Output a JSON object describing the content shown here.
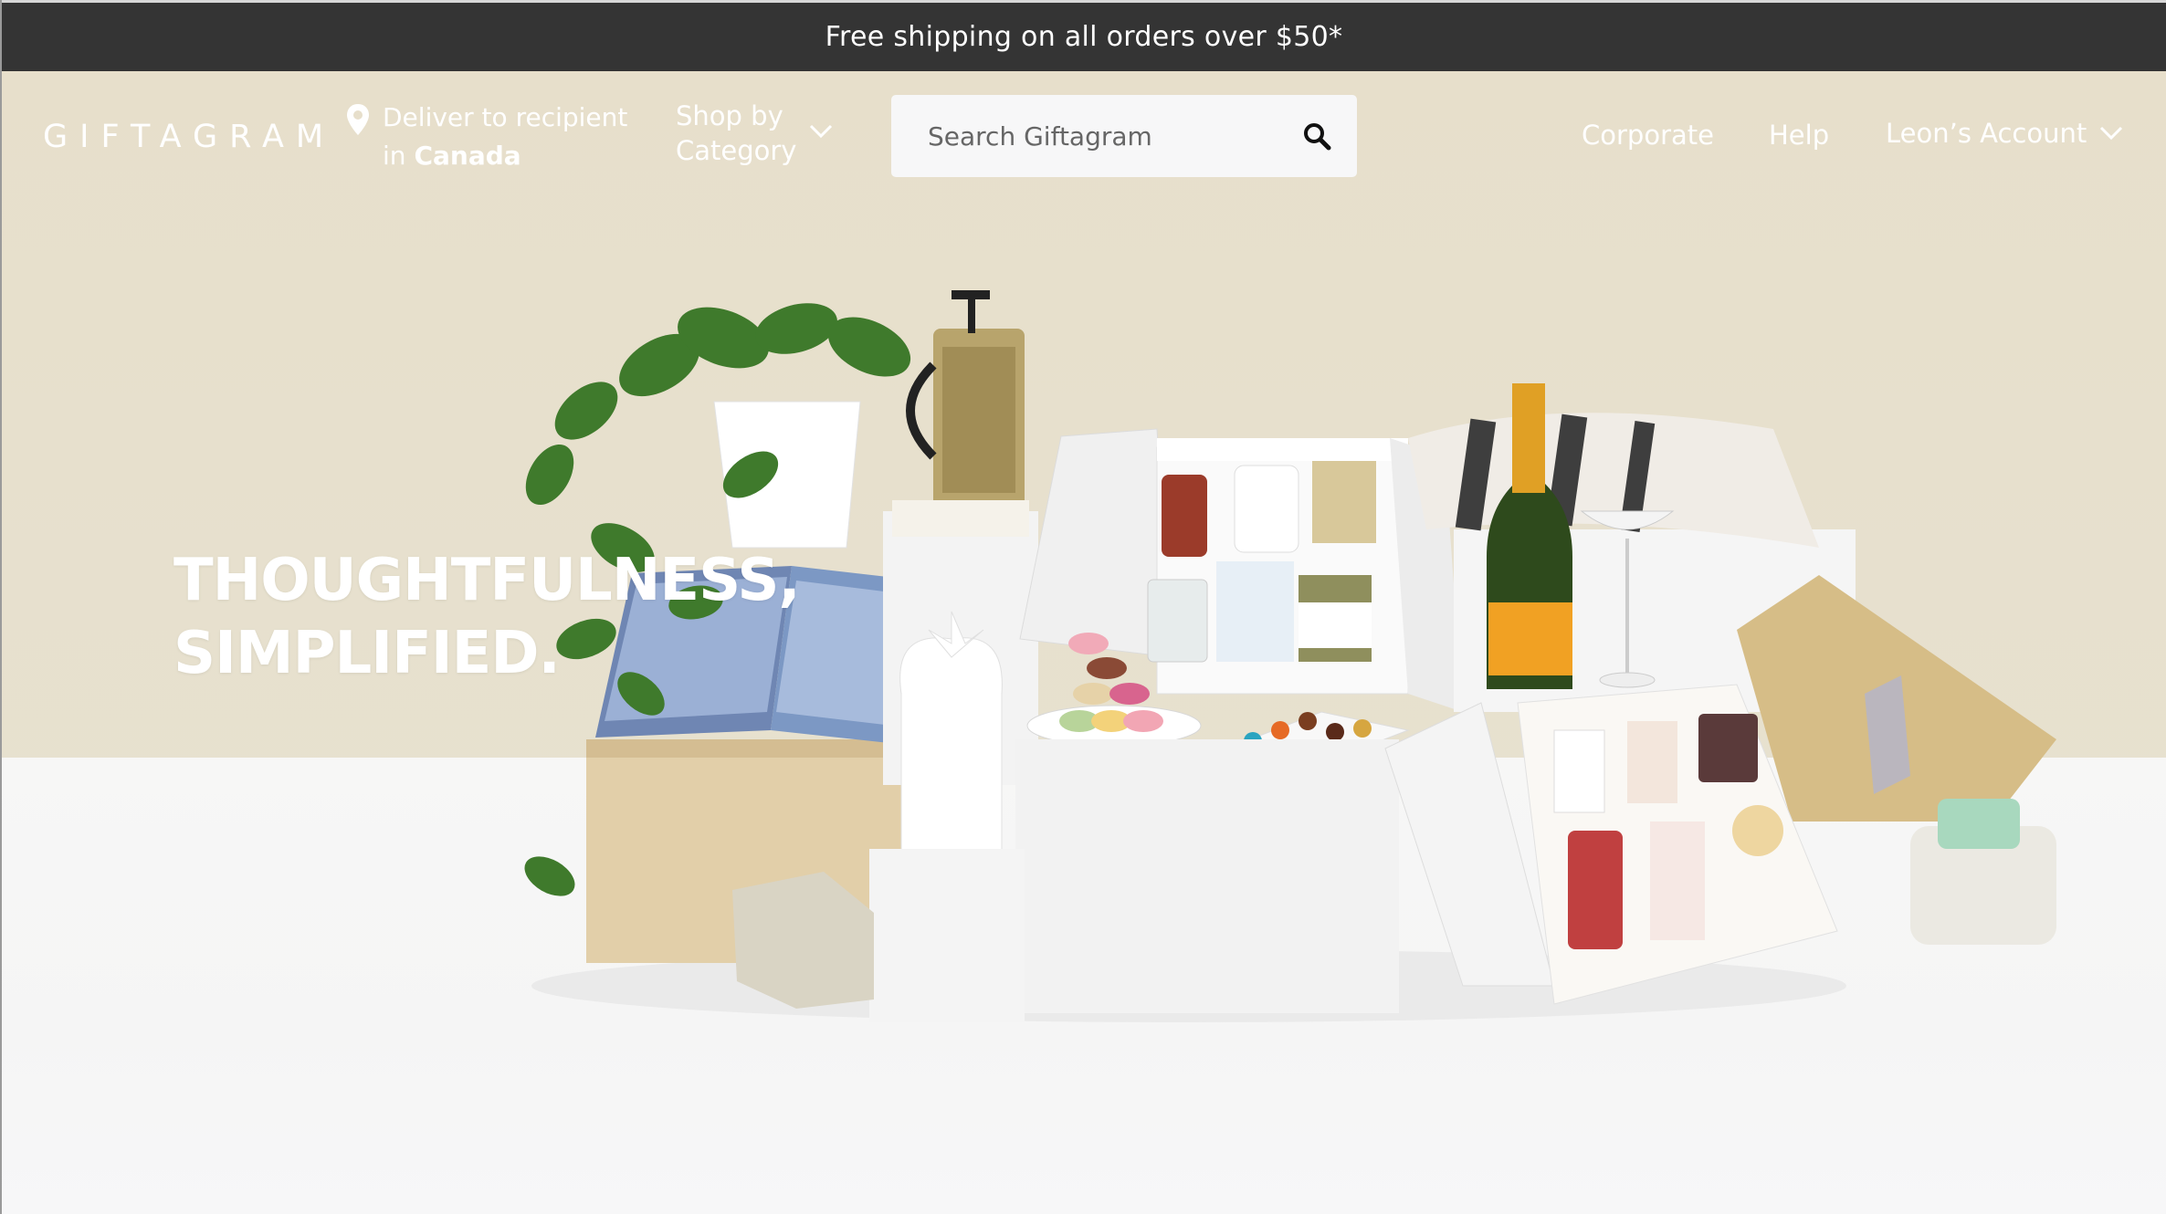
{
  "announcement": {
    "text": "Free shipping on all orders over $50*"
  },
  "header": {
    "logo": "GIFTAGRAM",
    "deliver": {
      "line1": "Deliver to recipient",
      "line2_prefix": "in ",
      "country": "Canada"
    },
    "shop_by": {
      "line1": "Shop by",
      "line2": "Category"
    },
    "search": {
      "placeholder": "Search Giftagram"
    },
    "nav": {
      "corporate": "Corporate",
      "help": "Help",
      "account": "Leon’s Account"
    }
  },
  "hero": {
    "headline_line1": "THOUGHTFULNESS,",
    "headline_line2": "SIMPLIFIED."
  },
  "colors": {
    "announce_bg": "#343434",
    "hero_bg": "#e7dfcb",
    "floor": "#f6f6f6",
    "text": "#ffffff"
  },
  "icons": [
    "location-pin-icon",
    "chevron-down-icon",
    "search-icon"
  ]
}
